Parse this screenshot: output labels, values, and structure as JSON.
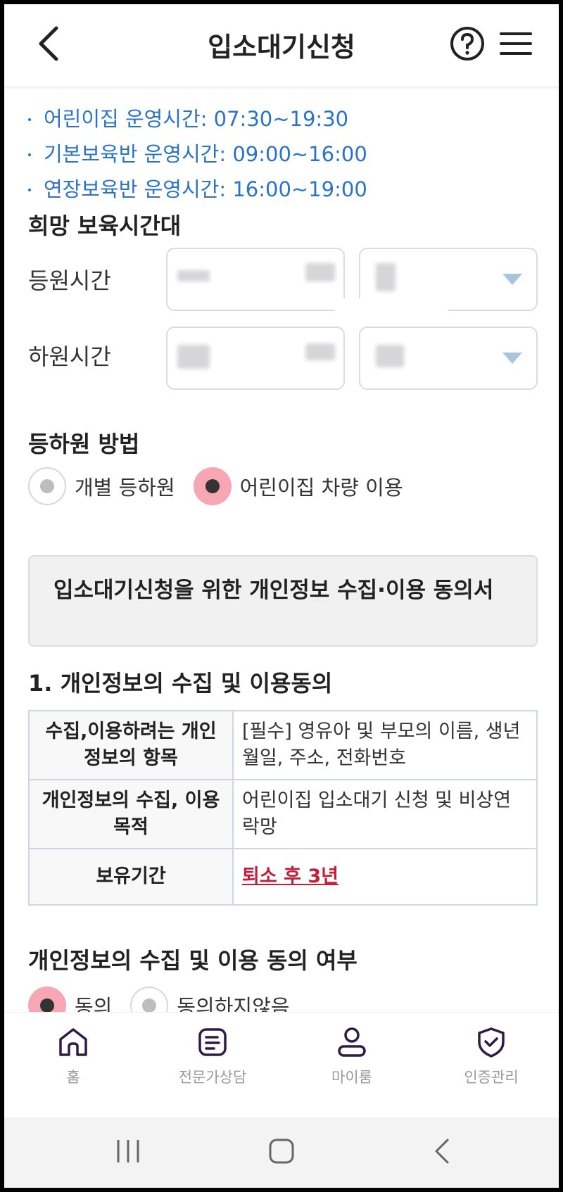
{
  "header": {
    "title": "입소대기신청",
    "icons": {
      "back": "chevron-left-icon",
      "help": "question-circle-icon",
      "menu": "hamburger-menu-icon"
    }
  },
  "hours_info": [
    "어린이집 운영시간: 07:30~19:30",
    "기본보육반 운영시간: 09:00~16:00",
    "연장보육반 운영시간: 16:00~19:00"
  ],
  "preferred_time": {
    "title": "희망 보육시간대",
    "arrival_label": "등원시간",
    "departure_label": "하원시간"
  },
  "commute": {
    "title": "등하원 방법",
    "options": [
      {
        "label": "개별 등하원",
        "selected": false
      },
      {
        "label": "어린이집 차량 이용",
        "selected": true
      }
    ]
  },
  "consent": {
    "box_title": "입소대기신청을 위한 개인정보 수집·이용 동의서",
    "section_title": "1. 개인정보의 수집 및 이용동의",
    "table": [
      {
        "header": "수집,이용하려는 개인정보의 항목",
        "value": "[필수] 영유아 및 부모의 이름, 생년월일, 주소, 전화번호"
      },
      {
        "header": "개인정보의 수집, 이용목적",
        "value": "어린이집 입소대기 신청 및 비상연락망"
      },
      {
        "header": "보유기간",
        "value": "퇴소 후 3년"
      }
    ],
    "agree_title": "개인정보의 수집 및 이용 동의 여부",
    "agree_options": [
      {
        "label": "동의",
        "selected": true
      },
      {
        "label": "동의하지않음",
        "selected": false
      }
    ]
  },
  "bottom_nav": [
    {
      "label": "홈",
      "icon": "home-icon"
    },
    {
      "label": "전문가상담",
      "icon": "document-icon"
    },
    {
      "label": "마이룸",
      "icon": "person-icon"
    },
    {
      "label": "인증관리",
      "icon": "shield-check-icon"
    }
  ],
  "colors": {
    "link_blue": "#2a73c8",
    "radio_pink": "#f7a6b3",
    "accent_red": "#c21f3a",
    "nav_icon": "#2f1b45"
  }
}
